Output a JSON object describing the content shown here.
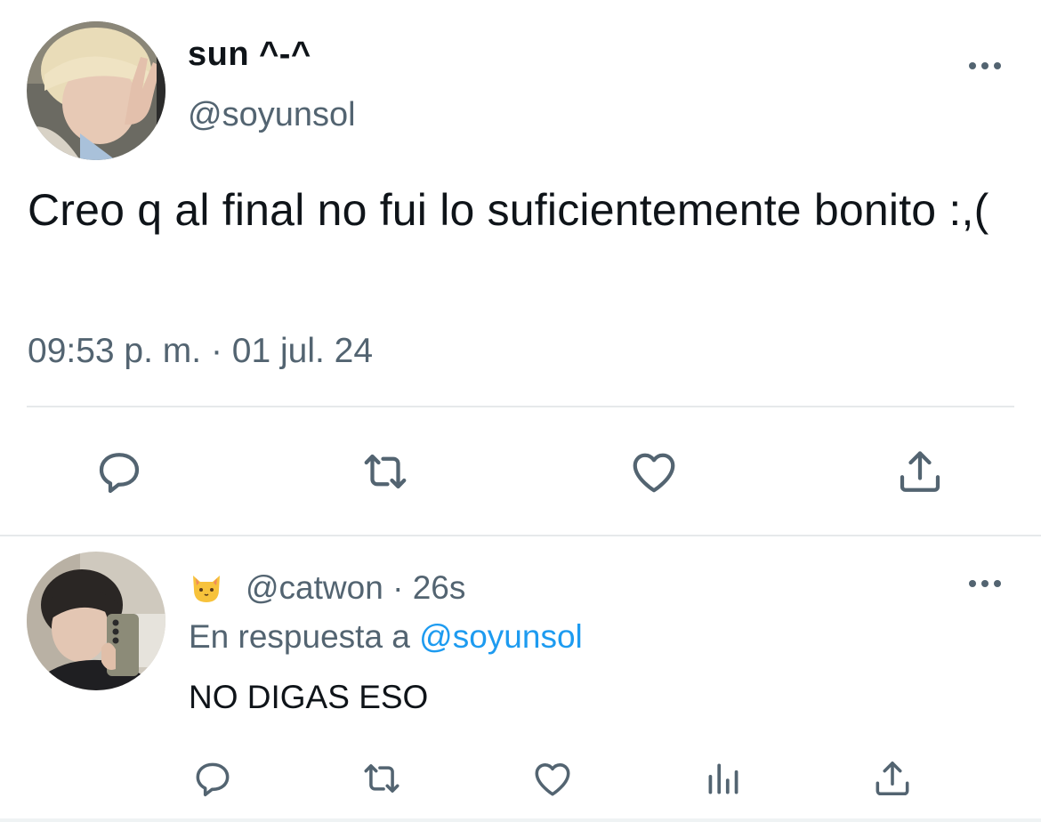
{
  "tweet": {
    "display_name": "sun ^-^",
    "handle": "@soyunsol",
    "text": "Creo q al final no fui lo suficientemente bonito :,(",
    "timestamp": "09:53 p. m. · 01 jul. 24",
    "actions": [
      "reply-icon",
      "retweet-icon",
      "like-icon",
      "share-icon"
    ]
  },
  "reply": {
    "emoji": "cat-face-icon",
    "handle": "@catwon",
    "separator": " · ",
    "time": "26s",
    "replying_prefix": "En respuesta a ",
    "replying_handle": "@soyunsol",
    "text": "NO DIGAS ESO",
    "actions": [
      "reply-icon",
      "retweet-icon",
      "like-icon",
      "views-icon",
      "share-icon"
    ]
  },
  "colors": {
    "text": "#0f1419",
    "secondary": "#536471",
    "mention": "#1d9bf0",
    "divider": "#e6e9eb"
  }
}
